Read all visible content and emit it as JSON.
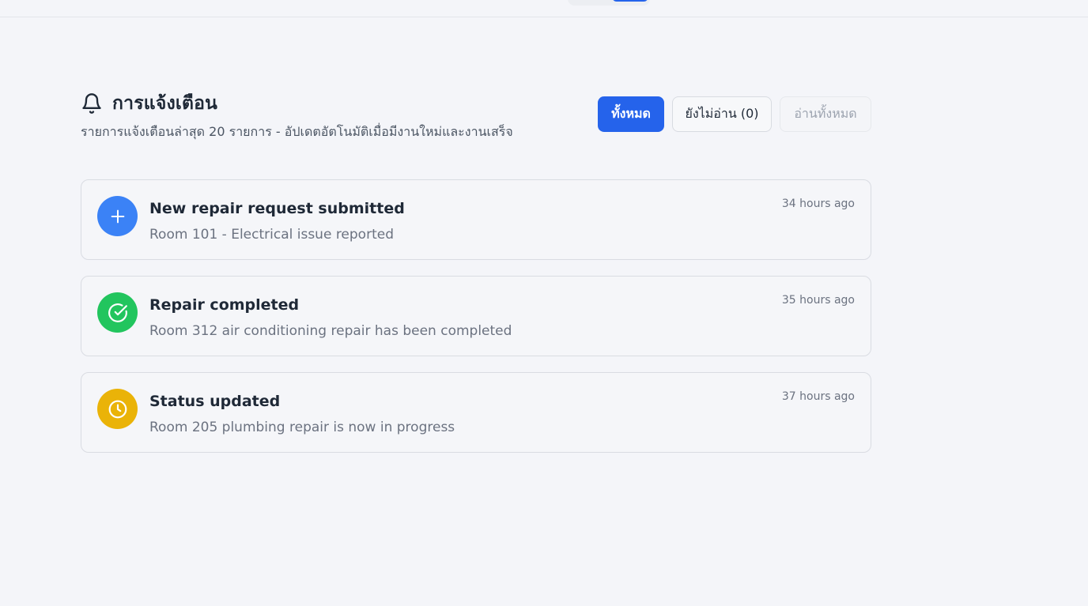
{
  "header": {
    "title": "การแจ้งเตือน",
    "subtitle": "รายการแจ้งเตือนล่าสุด 20 รายการ - อัปเดตอัตโนมัติเมื่อมีงานใหม่และงานเสร็จ"
  },
  "filters": {
    "all": "ทั้งหมด",
    "unread": "ยังไม่อ่าน (0)",
    "mark_all_read": "อ่านทั้งหมด"
  },
  "notifications": [
    {
      "icon": "plus-icon",
      "color": "#3b82f6",
      "title": "New repair request submitted",
      "description": "Room 101 - Electrical issue reported",
      "time": "34 hours ago"
    },
    {
      "icon": "check-circle-icon",
      "color": "#22c55e",
      "title": "Repair completed",
      "description": "Room 312 air conditioning repair has been completed",
      "time": "35 hours ago"
    },
    {
      "icon": "clock-icon",
      "color": "#eab308",
      "title": "Status updated",
      "description": "Room 205 plumbing repair is now in progress",
      "time": "37 hours ago"
    }
  ],
  "colors": {
    "accent": "#2563eb",
    "background": "#f4f5f9"
  }
}
